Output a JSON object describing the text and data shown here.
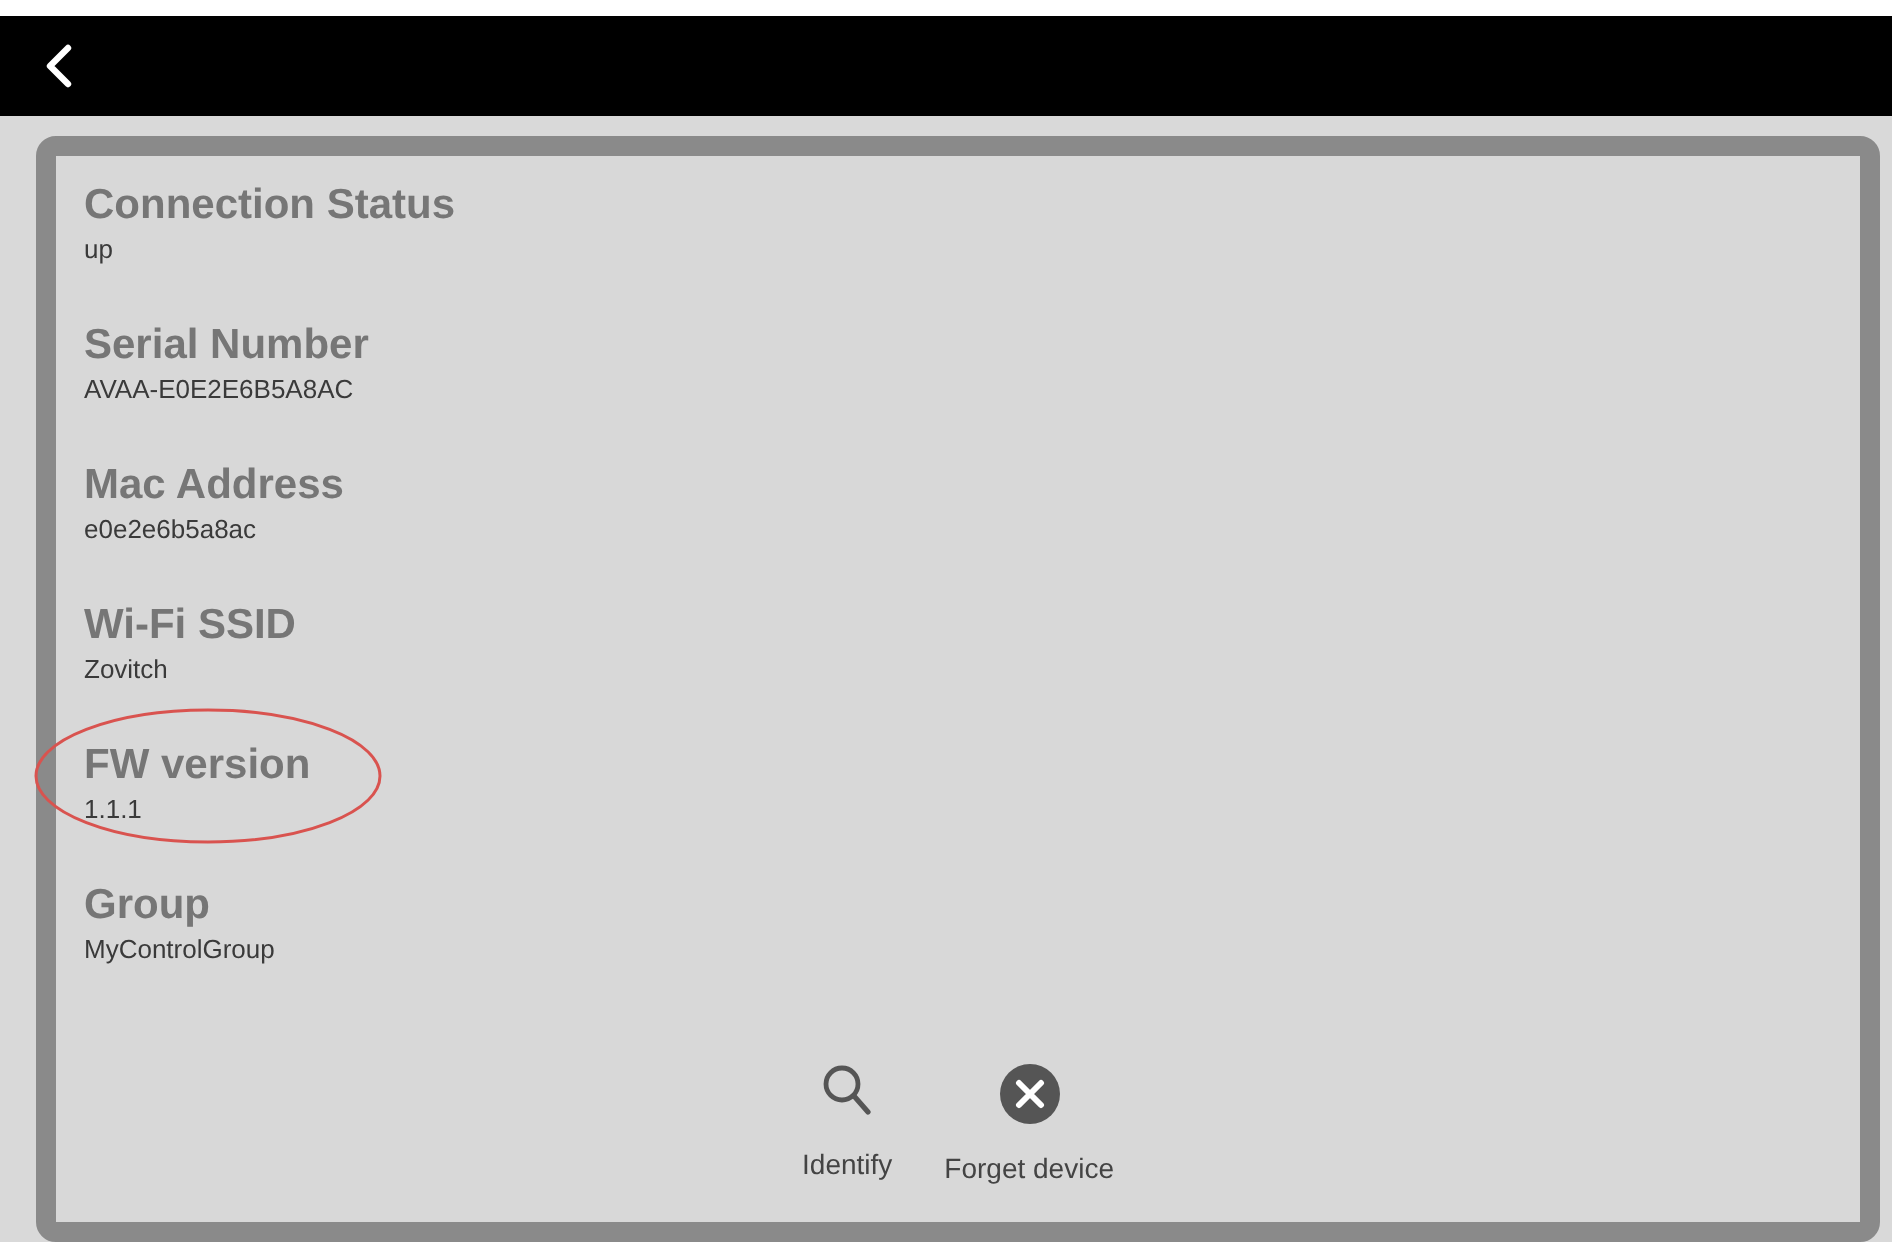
{
  "fields": [
    {
      "label": "Connection Status",
      "value": "up",
      "highlighted": false
    },
    {
      "label": "Serial Number",
      "value": "AVAA-E0E2E6B5A8AC",
      "highlighted": false
    },
    {
      "label": "Mac Address",
      "value": "e0e2e6b5a8ac",
      "highlighted": false
    },
    {
      "label": "Wi-Fi SSID",
      "value": "Zovitch",
      "highlighted": false
    },
    {
      "label": "FW version",
      "value": "1.1.1",
      "highlighted": true
    },
    {
      "label": "Group",
      "value": "MyControlGroup",
      "highlighted": false
    }
  ],
  "actions": [
    {
      "kind": "search",
      "label": "Identify"
    },
    {
      "kind": "remove",
      "label": "Forget device"
    }
  ]
}
